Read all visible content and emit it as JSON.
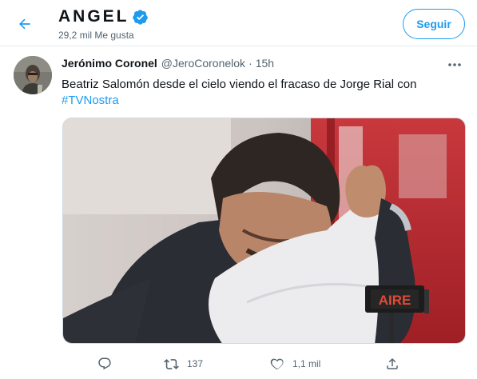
{
  "header": {
    "profile_name": "ANGEL",
    "likes_count": "29,2 mil Me gusta",
    "follow_label": "Seguir",
    "back_icon": "arrow-left-icon",
    "verified_icon": "verified-badge-icon"
  },
  "tweet": {
    "author_name": "Jerónimo Coronel",
    "author_handle": "@JeroCoronelok",
    "separator": "·",
    "time": "15h",
    "text": "Beatriz Salomón desde el cielo viendo el fracaso de Jorge Rial con",
    "hashtag": "#TVNostra",
    "media_overlay_text": "AIRE",
    "actions": {
      "reply_count": "",
      "retweet_count": "137",
      "like_count": "1,1 mil"
    }
  },
  "colors": {
    "accent": "#1d9bf0",
    "text_primary": "#0f1419",
    "text_secondary": "#536471",
    "divider": "#e6ecf0"
  }
}
